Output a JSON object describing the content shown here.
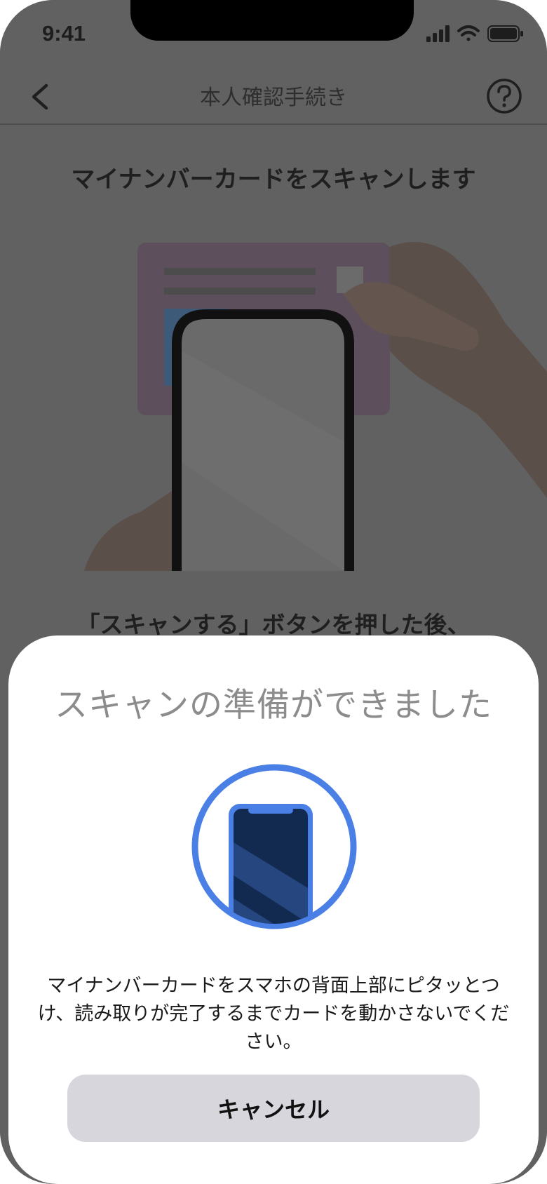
{
  "status_bar": {
    "time": "9:41",
    "icons": [
      "cellular-signal-icon",
      "wifi-icon",
      "battery-icon"
    ]
  },
  "nav": {
    "title": "本人確認手続き",
    "back_icon": "chevron-left-icon",
    "help_icon": "question-circle-icon"
  },
  "background": {
    "heading": "マイナンバーカードをスキャンします",
    "instruction": "「スキャンする」ボタンを押した後、"
  },
  "sheet": {
    "title": "スキャンの準備ができました",
    "graphic_icon": "phone-scan-icon",
    "description": "マイナンバーカードをスマホの背面上部にピタッとつけ、読み取りが完了するまでカードを動かさないでください。",
    "cancel_label": "キャンセル"
  },
  "colors": {
    "accent": "#4a7fe6",
    "phone_screen": "#132a50",
    "overlay_dim": "#616161",
    "button_bg": "#d6d6dc"
  }
}
